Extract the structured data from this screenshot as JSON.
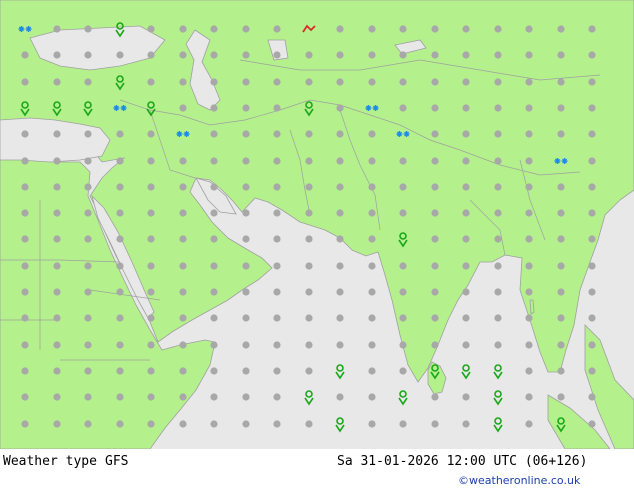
{
  "footer": {
    "product": "Weather type",
    "model": "GFS",
    "valid_time": "Sa 31-01-2026 12:00 UTC (06+126)",
    "credit": "©weatheronline.co.uk"
  },
  "colors": {
    "land": "#b4f08c",
    "sea": "#e8e8e8",
    "border": "#a0a0a0",
    "symbol_grey": "#a8a8a8",
    "rain_green": "#1aa81a",
    "snow_blue": "#1e8ce6",
    "thunder_red": "#dc2828"
  },
  "legend_icons": {
    "dry": "dot-icon",
    "rain": "rain-drop-icon",
    "snow": "snowflake-icon",
    "thunder": "thunder-icon"
  }
}
